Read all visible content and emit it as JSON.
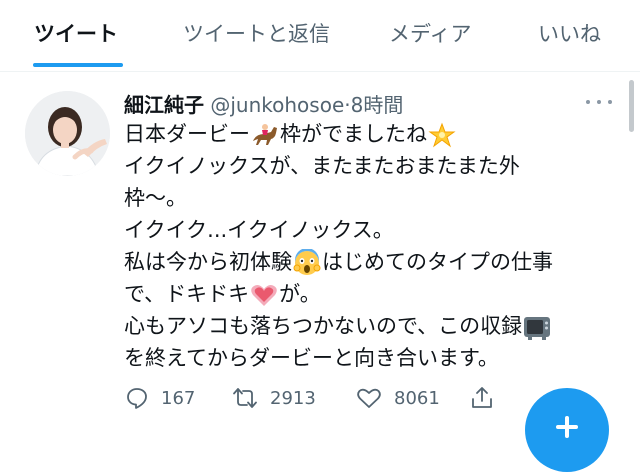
{
  "tabs": [
    {
      "label": "ツイート",
      "active": true
    },
    {
      "label": "ツイートと返信",
      "active": false
    },
    {
      "label": "メディア",
      "active": false
    },
    {
      "label": "いいね",
      "active": false
    }
  ],
  "tweet": {
    "author_name": "細江純子",
    "handle": "@junkohosoe",
    "separator": "·",
    "time": "8時間",
    "lines": [
      {
        "parts": [
          "日本ダービー",
          "枠がでましたね"
        ]
      },
      {
        "parts": [
          "イクイノックスが、またまたおまたまた外"
        ]
      },
      {
        "parts": [
          "枠〜。"
        ]
      },
      {
        "parts": [
          "イクイク...イクイノックス。"
        ]
      },
      {
        "parts": [
          "私は今から初体験",
          "はじめてのタイプの仕事"
        ]
      },
      {
        "parts": [
          "で、ドキドキ",
          "が。"
        ]
      },
      {
        "parts": [
          "心もアソコも落ちつかないので、この収録"
        ]
      },
      {
        "parts": [
          "を終えてからダービーと向き合います。"
        ]
      }
    ],
    "emojis": [
      "horse-racing-icon",
      "glowing-star-icon",
      "screaming-face-icon",
      "growing-heart-icon",
      "television-icon"
    ],
    "stats": {
      "replies": "167",
      "retweets": "2913",
      "likes": "8061"
    }
  },
  "colors": {
    "accent": "#1d9bf0",
    "text": "#0f1419",
    "muted": "#536471"
  }
}
